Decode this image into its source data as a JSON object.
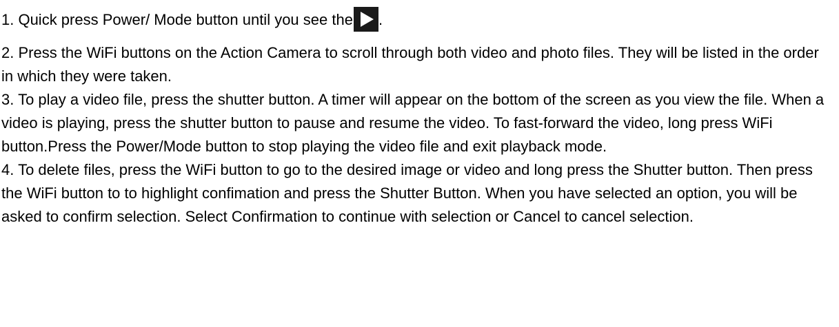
{
  "document": {
    "step1_before_icon": "1. Quick press Power/ Mode button until you see the",
    "step1_icon": "play-icon",
    "step1_after_icon": ".",
    "step2": "2. Press the WiFi buttons on the Action Camera to scroll through both video and photo files. They will be listed in the order in which they were taken.",
    "step3": "3. To play a video file, press the shutter button. A timer will appear on the bottom of the screen as you view the file. When a video is playing, press the shutter button to pause and resume the video. To fast-forward the video, long press WiFi button.Press the Power/Mode button to stop playing the video file and exit playback mode.",
    "step4": "4. To delete files, press the WiFi button to go to the desired image or video and long press the Shutter button. Then press the WiFi button to to highlight confimation and press the Shutter Button. When you have selected an option, you will be asked to confirm selection. Select Confirmation to continue with selection or Cancel to cancel selection."
  }
}
